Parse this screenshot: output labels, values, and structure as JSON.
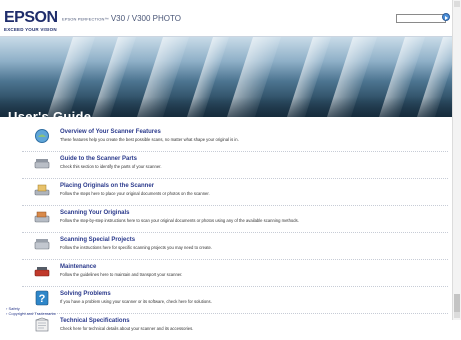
{
  "header": {
    "logo": "EPSON",
    "tagline": "EXCEED YOUR VISION",
    "product_prefix": "EPSON PERFECTION",
    "product_name": "V30 / V300 PHOTO"
  },
  "banner": {
    "title": "User's Guide"
  },
  "items": [
    {
      "title": "Overview of Your Scanner Features",
      "desc": "These features help you create the best possible scans, no matter what shape your original is in.",
      "icon": "photo-features-icon"
    },
    {
      "title": "Guide to the Scanner Parts",
      "desc": "Check this section to identify the parts of your scanner.",
      "icon": "scanner-parts-icon"
    },
    {
      "title": "Placing Originals on the Scanner",
      "desc": "Follow the steps here to place your original documents or photos on the scanner.",
      "icon": "placing-originals-icon"
    },
    {
      "title": "Scanning Your Originals",
      "desc": "Follow the step-by-step instructions here to scan your original documents or photos using any of the available scanning methods.",
      "icon": "scanning-icon"
    },
    {
      "title": "Scanning Special Projects",
      "desc": "Follow the instructions here for specific scanning projects you may need to create.",
      "icon": "special-projects-icon"
    },
    {
      "title": "Maintenance",
      "desc": "Follow the guidelines here to maintain and transport your scanner.",
      "icon": "maintenance-icon"
    },
    {
      "title": "Solving Problems",
      "desc": "If you have a problem using your scanner or its software, check here for solutions.",
      "icon": "solving-problems-icon"
    },
    {
      "title": "Technical Specifications",
      "desc": "Check here for technical details about your scanner and its accessories.",
      "icon": "technical-specs-icon"
    }
  ],
  "footer": {
    "safety": "Safety",
    "copyright": "Copyright and Trademarks"
  }
}
